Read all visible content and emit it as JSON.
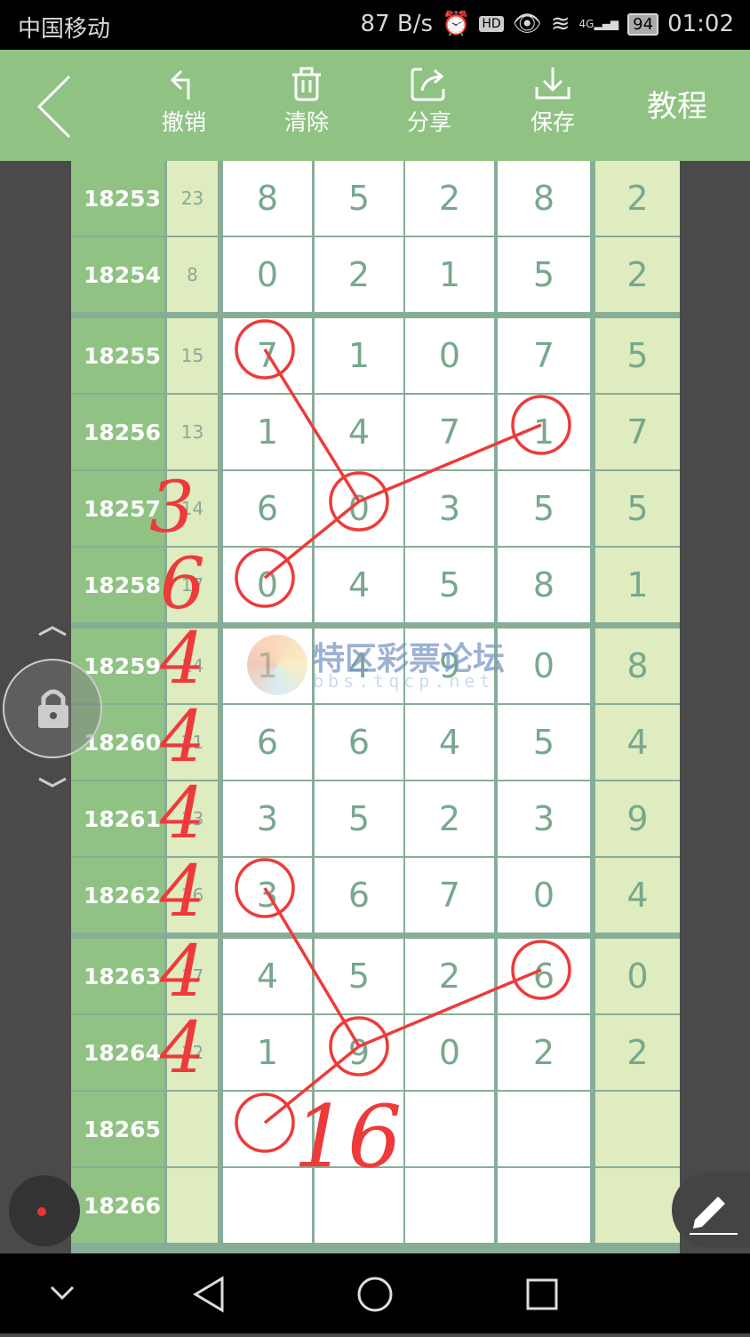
{
  "status_bar": {
    "carrier": "中国移动",
    "net_speed": "87 B/s",
    "battery": "94",
    "time": "01:02",
    "network": "4G"
  },
  "toolbar": {
    "back_icon": "chevron-left-icon",
    "undo": "撤销",
    "clear": "清除",
    "share": "分享",
    "save": "保存",
    "tutorial": "教程"
  },
  "rows": [
    {
      "id": "18253",
      "sum": "23",
      "digits": [
        "8",
        "5",
        "2",
        "8"
      ],
      "extra": "2"
    },
    {
      "id": "18254",
      "sum": "8",
      "digits": [
        "0",
        "2",
        "1",
        "5"
      ],
      "extra": "2"
    },
    {
      "id": "18255",
      "sum": "15",
      "digits": [
        "7",
        "1",
        "0",
        "7"
      ],
      "extra": "5"
    },
    {
      "id": "18256",
      "sum": "13",
      "digits": [
        "1",
        "4",
        "7",
        "1"
      ],
      "extra": "7"
    },
    {
      "id": "18257",
      "sum": "14",
      "digits": [
        "6",
        "0",
        "3",
        "5"
      ],
      "extra": "5"
    },
    {
      "id": "18258",
      "sum": "17",
      "digits": [
        "0",
        "4",
        "5",
        "8"
      ],
      "extra": "1"
    },
    {
      "id": "18259",
      "sum": "14",
      "digits": [
        "1",
        "4",
        "9",
        "0"
      ],
      "extra": "8"
    },
    {
      "id": "18260",
      "sum": "21",
      "digits": [
        "6",
        "6",
        "4",
        "5"
      ],
      "extra": "4"
    },
    {
      "id": "18261",
      "sum": "13",
      "digits": [
        "3",
        "5",
        "2",
        "3"
      ],
      "extra": "9"
    },
    {
      "id": "18262",
      "sum": "16",
      "digits": [
        "3",
        "6",
        "7",
        "0"
      ],
      "extra": "4"
    },
    {
      "id": "18263",
      "sum": "17",
      "digits": [
        "4",
        "5",
        "2",
        "6"
      ],
      "extra": "0"
    },
    {
      "id": "18264",
      "sum": "12",
      "digits": [
        "1",
        "9",
        "0",
        "2"
      ],
      "extra": "2"
    },
    {
      "id": "18265",
      "sum": "",
      "digits": [
        "",
        "",
        "",
        ""
      ],
      "extra": ""
    },
    {
      "id": "18266",
      "sum": "",
      "digits": [
        "",
        "",
        "",
        ""
      ],
      "extra": ""
    }
  ],
  "watermark": {
    "title": "特区彩票论坛",
    "url": "bbs.tqcp.net"
  },
  "annotations": {
    "color": "#ee3a3a",
    "handwritten": [
      "3",
      "6",
      "4",
      "4",
      "4",
      "4",
      "4",
      "4"
    ],
    "result": "16"
  },
  "floating": {
    "lock_icon": "lock-icon",
    "pen_icon": "pen-icon"
  },
  "colors": {
    "toolbar": "#8fc283",
    "id_column": "#8fc283",
    "sum_column": "#deecc0",
    "digit": "#78a88c",
    "grid": "#88ad97"
  }
}
